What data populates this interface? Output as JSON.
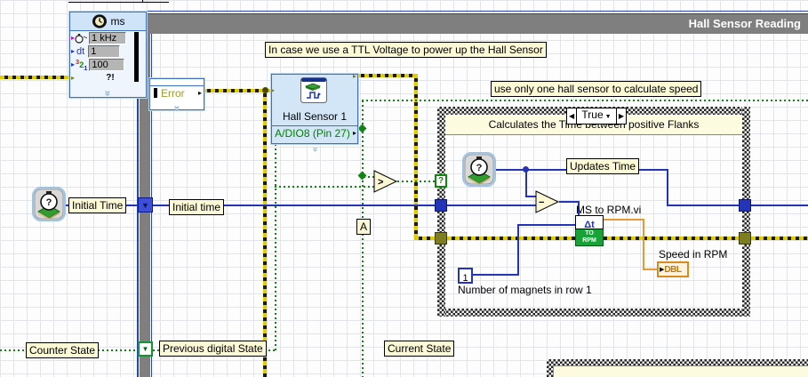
{
  "window": {
    "subdiagram_label": "Hall Sensor Reading"
  },
  "timer_node": {
    "title": "ms",
    "rows": [
      {
        "label": "",
        "value": "1 kHz"
      },
      {
        "label": "dt",
        "value": "1"
      },
      {
        "label": "",
        "value": "100"
      },
      {
        "label": "?!",
        "value": ""
      }
    ],
    "glyph_321": {
      "three": "3",
      "two": "2",
      "one": "1"
    }
  },
  "error_node": {
    "label": "Error"
  },
  "hall_sensor": {
    "name": "Hall Sensor 1",
    "channel": "A/DIO8 (Pin 27)"
  },
  "comments": {
    "ttl_note": "In case we use a TTL Voltage to power up the Hall Sensor",
    "one_sensor_note": "use only one hall sensor to calculate speed"
  },
  "labels": {
    "initial_time_constant": "Initial Time",
    "initial_time_wire": "Initial time",
    "counter_state": "Counter State",
    "previous_digital_state": "Previous digital State",
    "current_state": "Current State",
    "updates_time": "Updates Time",
    "point_a": "A"
  },
  "case_structure": {
    "selector_value": "True",
    "selector_prev": "◀",
    "selector_next": "▶",
    "selector_dropdown": "▼",
    "header": "Calculates the Time between positive Flanks"
  },
  "ms_to_rpm": {
    "caption": "MS to RPM.vi",
    "delta_label": "Δt",
    "box_top": "TO",
    "box_bottom": "RPM"
  },
  "magnet_constant": {
    "value": "1",
    "caption": "Number of magnets in row 1"
  },
  "speed_indicator": {
    "caption": "Speed in RPM",
    "type_label": "DBL"
  },
  "operators": {
    "subtract": "−",
    "greater": ">",
    "case_tunnel_question": "?",
    "error_glyph": "?!"
  },
  "colors": {
    "error_wire_yellow": "#e0cc00",
    "boolean_wire_green": "#128312",
    "numeric_wire_blue": "#2334b8",
    "dbl_wire_orange": "#e59a37",
    "structure_gray": "#7f7f7f",
    "label_bg": "#fcf9d6",
    "node_bg_blue": "#d2e6f7",
    "rpm_box_green": "#18a339",
    "channel_text_green": "#008000"
  }
}
